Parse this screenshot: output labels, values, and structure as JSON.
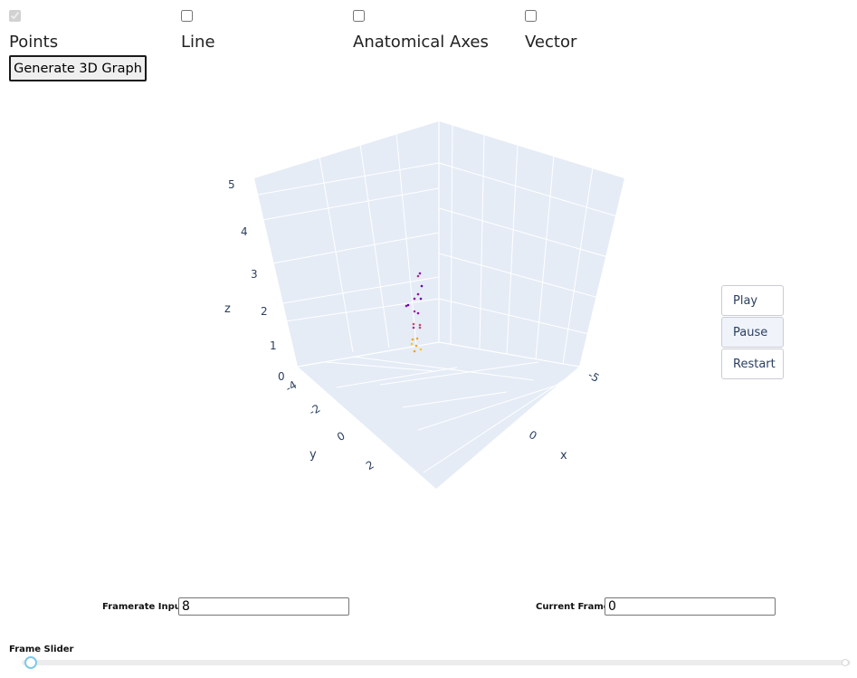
{
  "options": {
    "points": {
      "label": "Points",
      "checked": true,
      "disabled": true
    },
    "line": {
      "label": "Line",
      "checked": false
    },
    "anatomical_axes": {
      "label": "Anatomical Axes",
      "checked": false
    },
    "vector": {
      "label": "Vector",
      "checked": false
    }
  },
  "generate_button": {
    "label": "Generate 3D Graph"
  },
  "plot": {
    "background_color": "#e5ecf6",
    "grid_color": "#ffffff",
    "axes": {
      "x": {
        "title": "x",
        "ticks": [
          "-5",
          "0"
        ]
      },
      "y": {
        "title": "y",
        "ticks": [
          "-4",
          "-2",
          "0",
          "2"
        ]
      },
      "z": {
        "title": "z",
        "ticks": [
          "0",
          "1",
          "2",
          "3",
          "4",
          "5"
        ]
      }
    },
    "marker_colors": [
      "#8e0ea0",
      "#6a00a8",
      "#b12a90",
      "#d0436e",
      "#f0a51e",
      "#f6c338"
    ]
  },
  "animation_buttons": {
    "play": "Play",
    "pause": "Pause",
    "restart": "Restart"
  },
  "framerate": {
    "label": "Framerate Input:",
    "value": "8"
  },
  "current_frame": {
    "label": "Current Frame:",
    "value": "0"
  },
  "slider": {
    "label": "Frame Slider",
    "value": 0,
    "accent_color": "#7fc9e8"
  }
}
